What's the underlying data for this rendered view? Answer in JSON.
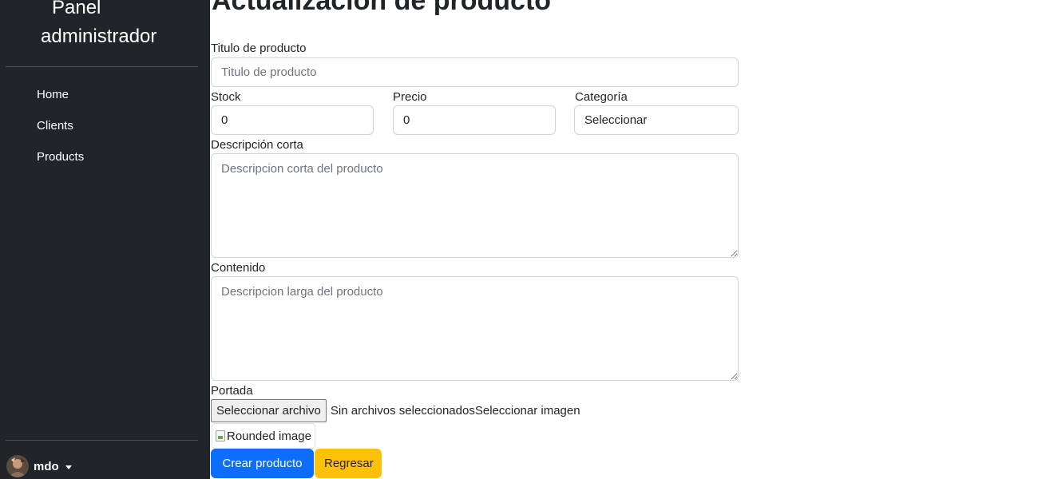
{
  "sidebar": {
    "brand_line1": "Panel",
    "brand_line2": "administrador",
    "items": [
      {
        "label": "Home"
      },
      {
        "label": "Clients"
      },
      {
        "label": "Products"
      }
    ],
    "user": {
      "name": "mdo"
    }
  },
  "page": {
    "title": "Actualización de producto"
  },
  "form": {
    "title_label": "Titulo de producto",
    "title_placeholder": "Titulo de producto",
    "stock_label": "Stock",
    "stock_value": "0",
    "price_label": "Precio",
    "price_value": "0",
    "category_label": "Categoría",
    "category_selected": "Seleccionar",
    "short_desc_label": "Descripción corta",
    "short_desc_placeholder": "Descripcion corta del producto",
    "content_label": "Contenido",
    "content_placeholder": "Descripcion larga del producto",
    "cover_label": "Portada",
    "file_button_label": "Seleccionar archivo",
    "file_status": "Sin archivos seleccionados",
    "file_hint": "Seleccionar imagen",
    "image_alt": "Rounded image",
    "submit_label": "Crear producto",
    "back_label": "Regresar"
  },
  "colors": {
    "sidebar_bg": "#212529",
    "primary": "#0d6efd",
    "warning": "#ffc107"
  }
}
